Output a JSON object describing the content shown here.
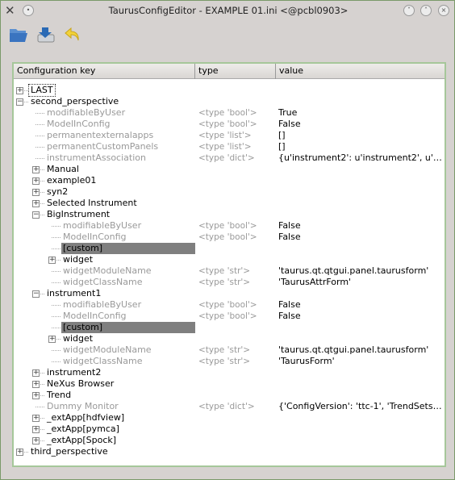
{
  "window": {
    "title": "TaurusConfigEditor - EXAMPLE 01.ini <@pcbl0903>"
  },
  "toolbar": {
    "icons": [
      "open-folder-icon",
      "save-icon",
      "undo-icon"
    ]
  },
  "tree": {
    "columns": [
      "Configuration key",
      "type",
      "value"
    ],
    "rows": [
      {
        "level": 0,
        "exp": "plus",
        "key": "LAST",
        "focus": true
      },
      {
        "level": 0,
        "exp": "minus",
        "key": "second_perspective"
      },
      {
        "level": 1,
        "key": "modifiableByUser",
        "type": "<type 'bool'>",
        "value": "True",
        "muted": true
      },
      {
        "level": 1,
        "key": "ModelInConfig",
        "type": "<type 'bool'>",
        "value": "False",
        "muted": true
      },
      {
        "level": 1,
        "key": "permanentexternalapps",
        "type": "<type 'list'>",
        "value": "[]",
        "muted": true
      },
      {
        "level": 1,
        "key": "permanentCustomPanels",
        "type": "<type 'list'>",
        "value": "[]",
        "muted": true
      },
      {
        "level": 1,
        "key": "instrumentAssociation",
        "type": "<type 'dict'>",
        "value": "{u'instrument2': u'instrument2', u'Bi…",
        "muted": true
      },
      {
        "level": 1,
        "exp": "plus",
        "key": "Manual"
      },
      {
        "level": 1,
        "exp": "plus",
        "key": "example01"
      },
      {
        "level": 1,
        "exp": "plus",
        "key": "syn2"
      },
      {
        "level": 1,
        "exp": "plus",
        "key": "Selected Instrument"
      },
      {
        "level": 1,
        "exp": "minus",
        "key": "BigInstrument"
      },
      {
        "level": 2,
        "key": "modifiableByUser",
        "type": "<type 'bool'>",
        "value": "False",
        "muted": true
      },
      {
        "level": 2,
        "key": "ModelInConfig",
        "type": "<type 'bool'>",
        "value": "False",
        "muted": true
      },
      {
        "level": 2,
        "key": "[custom]",
        "selected": true
      },
      {
        "level": 2,
        "exp": "plus",
        "key": "widget"
      },
      {
        "level": 2,
        "key": "widgetModuleName",
        "type": "<type 'str'>",
        "value": "'taurus.qt.qtgui.panel.taurusform'",
        "muted": true
      },
      {
        "level": 2,
        "key": "widgetClassName",
        "type": "<type 'str'>",
        "value": "'TaurusAttrForm'",
        "muted": true
      },
      {
        "level": 1,
        "exp": "minus",
        "key": "instrument1"
      },
      {
        "level": 2,
        "key": "modifiableByUser",
        "type": "<type 'bool'>",
        "value": "False",
        "muted": true
      },
      {
        "level": 2,
        "key": "ModelInConfig",
        "type": "<type 'bool'>",
        "value": "False",
        "muted": true
      },
      {
        "level": 2,
        "key": "[custom]",
        "selected": true
      },
      {
        "level": 2,
        "exp": "plus",
        "key": "widget"
      },
      {
        "level": 2,
        "key": "widgetModuleName",
        "type": "<type 'str'>",
        "value": "'taurus.qt.qtgui.panel.taurusform'",
        "muted": true
      },
      {
        "level": 2,
        "key": "widgetClassName",
        "type": "<type 'str'>",
        "value": "'TaurusForm'",
        "muted": true
      },
      {
        "level": 1,
        "exp": "plus",
        "key": "instrument2"
      },
      {
        "level": 1,
        "exp": "plus",
        "key": "NeXus Browser"
      },
      {
        "level": 1,
        "exp": "plus",
        "key": "Trend"
      },
      {
        "level": 1,
        "key": "Dummy Monitor",
        "type": "<type 'dict'>",
        "value": "{'ConfigVersion': 'ttc-1', 'TrendSets':…",
        "muted": true
      },
      {
        "level": 1,
        "exp": "plus",
        "key": "_extApp[hdfview]"
      },
      {
        "level": 1,
        "exp": "plus",
        "key": "_extApp[pymca]"
      },
      {
        "level": 1,
        "exp": "plus",
        "key": "_extApp[Spock]"
      },
      {
        "level": 0,
        "exp": "plus",
        "key": "third_perspective"
      }
    ]
  }
}
